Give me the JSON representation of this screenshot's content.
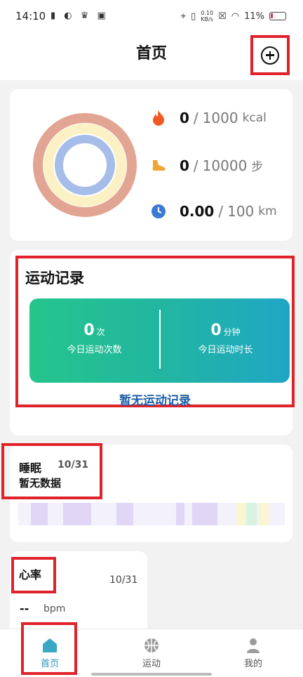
{
  "status_bar": {
    "time": "14:10",
    "net_speed_value": "0.10",
    "net_speed_unit": "KB/s",
    "battery": "11%"
  },
  "header": {
    "title": "首页",
    "add_icon": "plus-circle-icon"
  },
  "activity": {
    "rings": [
      {
        "name": "calories",
        "color": "#e3a593",
        "progress": 0
      },
      {
        "name": "steps",
        "color": "#fbf1c4",
        "progress": 0
      },
      {
        "name": "distance",
        "color": "#a7bde9",
        "progress": 0
      }
    ],
    "metrics": [
      {
        "icon": "flame-icon",
        "color": "#f05a22",
        "current": "0",
        "sep": "/",
        "goal": "1000",
        "unit": "kcal"
      },
      {
        "icon": "shoe-icon",
        "color": "#f0a535",
        "current": "0",
        "sep": "/",
        "goal": "10000",
        "unit": "步"
      },
      {
        "icon": "clock-icon",
        "color": "#3a7bd5",
        "current": "0.00",
        "sep": "/",
        "goal": "100",
        "unit": "km"
      }
    ]
  },
  "records": {
    "title": "运动记录",
    "count_value": "0",
    "count_unit": "次",
    "count_label": "今日运动次数",
    "duration_value": "0",
    "duration_unit": "分钟",
    "duration_label": "今日运动时长",
    "empty_text": "暂无运动记录",
    "gradient": [
      "#25c58c",
      "#1fa6c6"
    ]
  },
  "sleep": {
    "title": "睡眠",
    "date": "10/31",
    "no_data": "暂无数据"
  },
  "heart": {
    "title": "心率",
    "date": "10/31",
    "value": "--",
    "unit": "bpm"
  },
  "tabbar": {
    "items": [
      {
        "label": "首页",
        "icon": "home-icon",
        "active": true
      },
      {
        "label": "运动",
        "icon": "basketball-icon",
        "active": false
      },
      {
        "label": "我的",
        "icon": "person-icon",
        "active": false
      }
    ],
    "active_color": "#2a92b8"
  }
}
